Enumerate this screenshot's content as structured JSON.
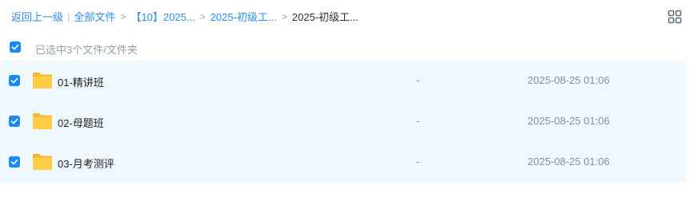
{
  "breadcrumb": {
    "back_label": "返回上一级",
    "items": [
      "全部文件",
      "【10】2025...",
      "2025-初级工...",
      "2025-初级工..."
    ]
  },
  "toolbar": {
    "view_toggle_icon": "grid-view-icon"
  },
  "selection": {
    "checked": true,
    "text": "已选中3个文件/文件夹"
  },
  "files": [
    {
      "name": "01-精讲班",
      "size": "-",
      "modified": "2025-08-25 01:06",
      "checked": true,
      "icon": "folder-icon"
    },
    {
      "name": "02-母题班",
      "size": "-",
      "modified": "2025-08-25 01:06",
      "checked": true,
      "icon": "folder-icon"
    },
    {
      "name": "03-月考测评",
      "size": "-",
      "modified": "2025-08-25 01:06",
      "checked": true,
      "icon": "folder-icon"
    }
  ],
  "colors": {
    "accent": "#2e8ef3",
    "checkbox": "#1a88f7",
    "row_selected_bg": "#eff7ff",
    "folder": "#ffc93a"
  }
}
